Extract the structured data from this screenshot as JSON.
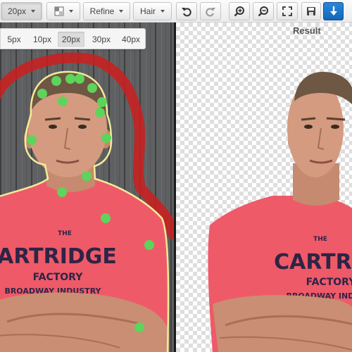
{
  "toolbar": {
    "brush_size": "20px",
    "refine_label": "Refine",
    "hair_label": "Hair",
    "icons": [
      "view-mode-icon",
      "undo-icon",
      "redo-icon",
      "zoom-in-icon",
      "zoom-out-icon",
      "fit-screen-icon",
      "save-icon",
      "download-icon"
    ],
    "primary_color": "#1a6fc6"
  },
  "brush_popup": {
    "sizes": [
      "5px",
      "10px",
      "20px",
      "30px",
      "40px"
    ],
    "selected": "20px"
  },
  "result_pane": {
    "title": "Result"
  },
  "photo": {
    "shirt_text": {
      "small": "THE",
      "main": "CARTRIDGE",
      "sub": "FACTORY",
      "bottom": "BROADWAY INDUSTRY"
    }
  },
  "colors": {
    "foreground_marker": "#5ed45b",
    "background_marker": "#d21e1e",
    "cutout_outline": "#f2eb9a",
    "shirt": "#f25a68"
  }
}
